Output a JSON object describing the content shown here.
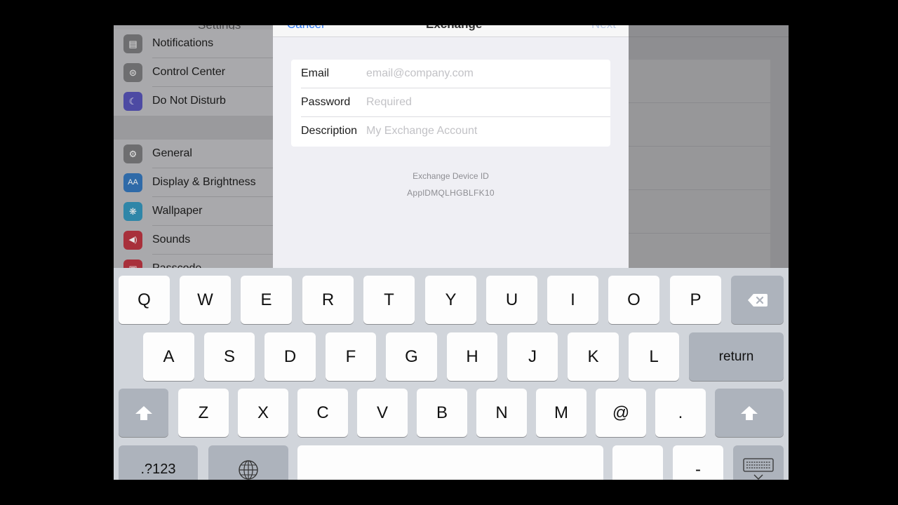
{
  "settings_title": "Settings",
  "sidebar": {
    "items": [
      {
        "label": "Notifications",
        "icon": "notifications-icon",
        "color": "#6e6e70",
        "glyph": "▤"
      },
      {
        "label": "Control Center",
        "icon": "control-center-icon",
        "color": "#6e6e70",
        "glyph": "⊜"
      },
      {
        "label": "Do Not Disturb",
        "icon": "moon-icon",
        "color": "#4d4aa3",
        "glyph": "☾"
      },
      {
        "label": "General",
        "icon": "gear-icon",
        "color": "#6e6e70",
        "glyph": "⚙"
      },
      {
        "label": "Display & Brightness",
        "icon": "display-brightness-icon",
        "color": "#2f6aa8",
        "glyph": "AA"
      },
      {
        "label": "Wallpaper",
        "icon": "wallpaper-icon",
        "color": "#2f86a8",
        "glyph": "❋"
      },
      {
        "label": "Sounds",
        "icon": "speaker-icon",
        "color": "#a8303b",
        "glyph": "◀)"
      },
      {
        "label": "Passcode",
        "icon": "lock-icon",
        "color": "#a8303b",
        "glyph": "▣"
      }
    ]
  },
  "modal": {
    "cancel_label": "Cancel",
    "title": "Exchange",
    "next_label": "Next",
    "fields": [
      {
        "label": "Email",
        "placeholder": "email@company.com",
        "value": ""
      },
      {
        "label": "Password",
        "placeholder": "Required",
        "value": ""
      },
      {
        "label": "Description",
        "placeholder": "My Exchange Account",
        "value": ""
      }
    ],
    "device_id_title": "Exchange Device ID",
    "device_id_value": "ApplDMQLHGBLFK10"
  },
  "keyboard": {
    "row1": [
      "Q",
      "W",
      "E",
      "R",
      "T",
      "Y",
      "U",
      "I",
      "O",
      "P"
    ],
    "row2": [
      "A",
      "S",
      "D",
      "F",
      "G",
      "H",
      "J",
      "K",
      "L"
    ],
    "row3": [
      "Z",
      "X",
      "C",
      "V",
      "B",
      "N",
      "M",
      "@",
      "."
    ],
    "return_label": "return",
    "numbers_label": ".?123",
    "dash_label": "-",
    "key_bg": "#fdfdfd",
    "special_key_bg": "#adb3bc",
    "keyboard_bg": "#d1d5db"
  }
}
